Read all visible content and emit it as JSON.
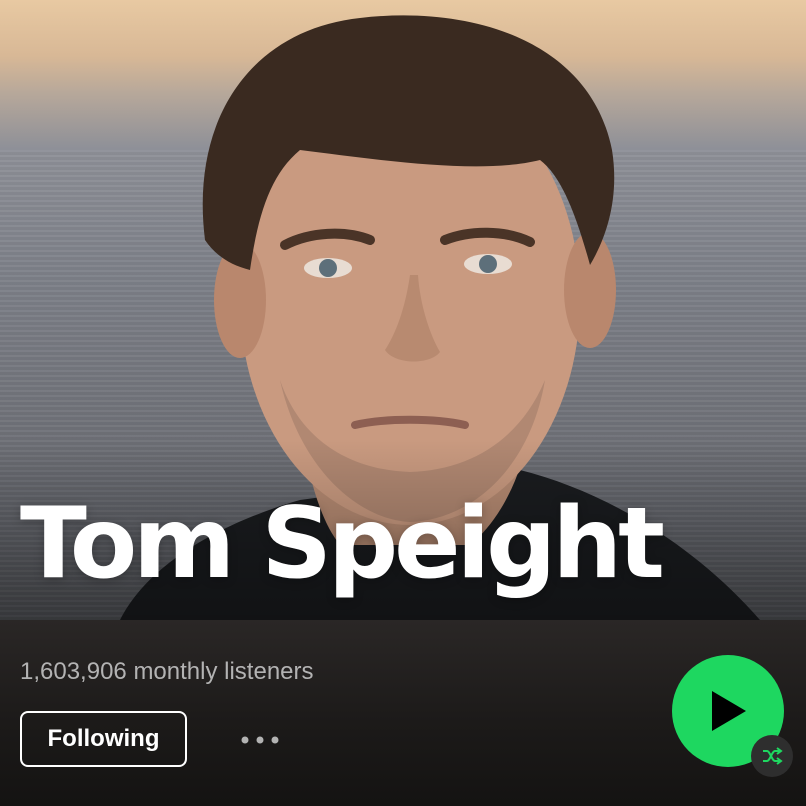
{
  "artist": {
    "name": "Tom Speight",
    "monthly_listeners": "1,603,906 monthly listeners",
    "image": "artist-portrait"
  },
  "actions": {
    "follow_label": "Following",
    "more_icon": "more-horizontal-icon",
    "play_icon": "play-icon",
    "shuffle_icon": "shuffle-icon"
  },
  "colors": {
    "accent": "#1ed760",
    "background": "#121212",
    "text_primary": "#ffffff",
    "text_secondary": "#b3b3b3"
  }
}
